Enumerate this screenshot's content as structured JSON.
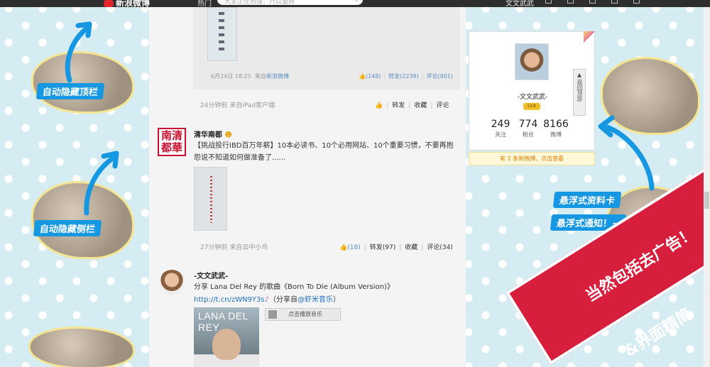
{
  "topbar": {
    "logo": "新浪微博",
    "hot": "热门",
    "search_placeholder": "大家正在热搜：六以量尚",
    "user": "文文武武"
  },
  "forward_block": {
    "meta_date": "6月24日 18:25",
    "meta_from": "来自",
    "meta_source": "新浪微博",
    "like_count": "(148)",
    "repost": "转发(2239)",
    "comment": "评论(901)"
  },
  "post0": {
    "meta": "24分钟前 来自iPad客户端",
    "repost": "转发",
    "favorite": "收藏",
    "comment": "评论"
  },
  "post1": {
    "avatar_text": "南清都華",
    "author": "清华南都",
    "text": "【挑战投行IBD百万年薪】10本必读书、10个必用网站、10个重要习惯，不要再抱怨说不知道如何做准备了......",
    "meta": "27分钟前 来自云中小鸟",
    "like": "(18)",
    "repost": "转发(97)",
    "favorite": "收藏",
    "comment": "评论(34)"
  },
  "post2": {
    "author": "-文文武武-",
    "text": "分享 Lana Del Rey 的歌曲《Born To Die (Album Version)》",
    "link": "http://t.cn/zWN9Y3s",
    "share_from": "（分享自",
    "share_source": "@虾米音乐",
    "share_close": "）",
    "cover_title": "LANA DEL REY",
    "play_label": "点击播放音乐"
  },
  "profile_card": {
    "name": "-文文武武-",
    "badge": "LV.8",
    "stats": [
      {
        "num": "249",
        "label": "关注"
      },
      {
        "num": "774",
        "label": "粉丝"
      },
      {
        "num": "8166",
        "label": "微博"
      }
    ],
    "back_to_top": "返回顶部",
    "notice": "有 2 条新微博，点击查看"
  },
  "promo": {
    "hide_top": "自动隐藏顶栏",
    "hide_side": "自动隐藏侧栏",
    "float_card": "悬浮式资料卡",
    "float_notice": "悬浮式通知！~",
    "ribbon_1": "当然包括去广告！",
    "ribbon_2": "&界面精简"
  },
  "colors": {
    "accent": "#1697e2",
    "ribbon": "#d81e3d",
    "link": "#1f6fbf"
  }
}
